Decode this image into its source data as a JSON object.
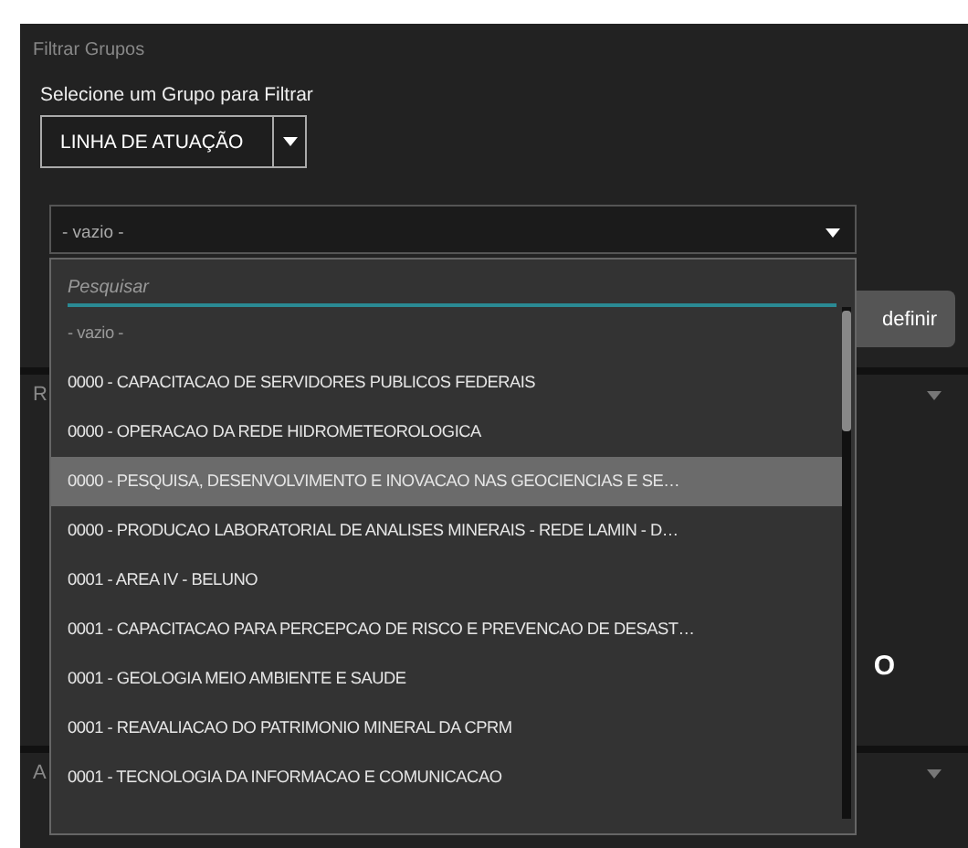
{
  "panel": {
    "title": "Filtrar Grupos"
  },
  "group_label": "Selecione um Grupo para Filtrar",
  "group_select": {
    "value": "LINHA DE ATUAÇÃO"
  },
  "value_select": {
    "value": "- vazio -",
    "expanded": true
  },
  "dropdown": {
    "search": {
      "placeholder": "Pesquisar"
    },
    "options": [
      {
        "label": "- vazio -",
        "kind": "empty",
        "selected": false
      },
      {
        "label": "0000 - CAPACITACAO DE SERVIDORES PUBLICOS FEDERAIS",
        "kind": "item",
        "selected": false
      },
      {
        "label": "0000 - OPERACAO DA REDE HIDROMETEOROLOGICA",
        "kind": "item",
        "selected": false
      },
      {
        "label": "0000 - PESQUISA, DESENVOLVIMENTO E INOVACAO NAS GEOCIENCIAS E SE…",
        "kind": "item",
        "selected": true
      },
      {
        "label": "0000 - PRODUCAO LABORATORIAL DE ANALISES MINERAIS - REDE LAMIN - D…",
        "kind": "item",
        "selected": false
      },
      {
        "label": "0001 - AREA IV - BELUNO",
        "kind": "item",
        "selected": false
      },
      {
        "label": "0001 - CAPACITACAO PARA PERCEPCAO DE RISCO E PREVENCAO DE DESAST…",
        "kind": "item",
        "selected": false
      },
      {
        "label": "0001 - GEOLOGIA MEIO AMBIENTE E SAUDE",
        "kind": "item",
        "selected": false
      },
      {
        "label": "0001 - REAVALIACAO DO PATRIMONIO MINERAL DA CPRM",
        "kind": "item",
        "selected": false
      },
      {
        "label": "0001 - TECNOLOGIA DA INFORMACAO E COMUNICACAO",
        "kind": "item",
        "selected": false
      }
    ]
  },
  "background": {
    "button": "definir",
    "section_1": "R",
    "big_text": "O",
    "section_2": "A"
  }
}
